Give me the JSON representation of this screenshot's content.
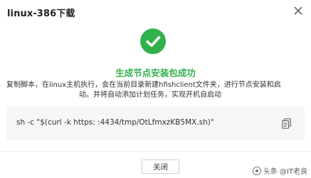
{
  "dialog": {
    "title": "linux-386下载",
    "success_title": "生成节点安装包成功",
    "description_line1": "复制脚本，在linux主机执行，会在当前目录新建hfishclient文件夹，进行节点安装和启",
    "description_line2": "动。并将自动添加计划任务，实现开机自启动",
    "command": "sh -c \"$(curl -k https:                   :4434/tmp/OtLfmxzKB5MX.sh)\"",
    "close_button_label": "关闭"
  },
  "watermark": {
    "text": "头条 @IT老良"
  },
  "colors": {
    "success": "#31b14b",
    "command_bg": "#f6f6f6"
  },
  "icons": {
    "close": "close-icon",
    "success": "check-circle-icon",
    "copy": "copy-icon"
  }
}
